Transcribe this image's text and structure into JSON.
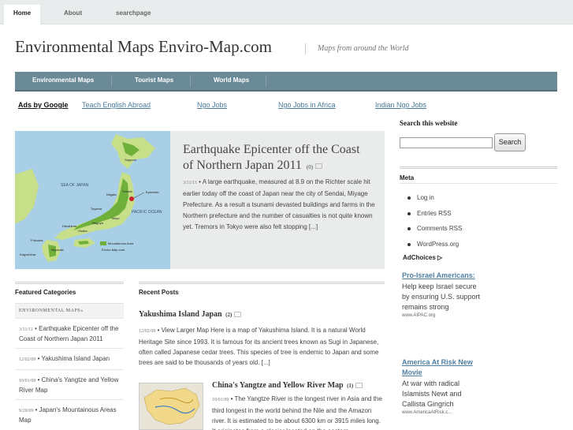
{
  "topnav": {
    "home": "Home",
    "about": "About",
    "searchpage": "searchpage"
  },
  "site": {
    "title": "Environmental Maps Enviro-Map.com",
    "tagline": "Maps from around the World"
  },
  "mainnav": {
    "items": [
      "Environmental Maps",
      "Tourist Maps",
      "World Maps"
    ]
  },
  "ads": {
    "label": "Ads by Google",
    "links": [
      "Teach English Abroad",
      "Ngo Jobs",
      "Ngo Jobs in Africa",
      "Indian Ngo Jobs"
    ]
  },
  "feature": {
    "title": "Earthquake Epicenter off the Coast of Northern Japan 2011",
    "comment_count": "(0)",
    "date": "3/11/11",
    "excerpt": " • A large earthquake, measured at 8.9 on the Richter scale hit earlier today off the coast of Japan near the city of Sendai, Miyage Prefecture. As a result a tsunami devasted buildings and farms in the Northern prefecture and the number of casualties is not quite known yet. Tremors in Tokyo were also felt stopping [...]",
    "map_labels": {
      "sea": "SEA OF JAPAN",
      "ocean": "PACIFIC OCEAN",
      "epicenter": "Epicenter",
      "legend1": "Mountainous Area",
      "legend2": "Enviro-Map.com",
      "cities": [
        "Sapporo",
        "Sendai",
        "Niigata",
        "Tokyo",
        "Nagoya",
        "Osaka",
        "Kyoto",
        "Hiroshima",
        "Fukuoka",
        "Kagoshima",
        "Shikoku",
        "Kyushu",
        "Honshu",
        "Hokkaido",
        "Toyama",
        "Kanazawa",
        "Yokohama",
        "Miyazaki"
      ]
    }
  },
  "featured": {
    "heading": "Featured Categories",
    "category": "Environmental Maps»",
    "items": [
      {
        "date": "3/11/11",
        "title": "Earthquake Epicenter off the Coast of Northern Japan 2011"
      },
      {
        "date": "12/02/09",
        "title": "Yakushima Island Japan"
      },
      {
        "date": "10/01/09",
        "title": "China's Yangtze and Yellow River Map"
      },
      {
        "date": "9/20/09",
        "title": "Japan's Mountainous Areas Map"
      }
    ]
  },
  "recent": {
    "heading": "Recent Posts",
    "post1": {
      "title": "Yakushima Island Japan",
      "count": "(2)",
      "date": "12/02/09",
      "body": " • View Larger Map Here is a map of Yakushima Island. It is a natural World Heritage Site since 1993. It is famous for its ancient trees known as Sugi in Japanese, often called Japanese cedar trees. This species of tree is endemic to Japan and some trees are said to be thousands of years old. [...]"
    },
    "post2": {
      "title": "China's Yangtze and Yellow River Map",
      "count": "(1)",
      "date": "10/01/09",
      "body": " • The Yangtze River is the longest river in Asia and the third longest in the world behind the Nile and the Amazon river. It is estimated to be about 6300 km or 3915 miles long. It originates from a glacier located on the eastern"
    }
  },
  "sidebar": {
    "search_label": "Search this website",
    "search_value": "",
    "search_button": "Search",
    "meta_heading": "Meta",
    "meta_links": [
      "Log in",
      "Entries RSS",
      "Comments RSS",
      "WordPress.org"
    ],
    "adchoices": "AdChoices",
    "ad1": {
      "title": "Pro-Israel Americans:",
      "text": "Help keep Israel secure by ensuring U.S. support remains strong",
      "url": "www.AIPAC.org"
    },
    "ad2": {
      "title": "America At Risk New Movie",
      "text": "At war with radical Islamists Newt and Callista Gingrich",
      "url": "www.AmericaAtRisk.c..."
    }
  },
  "colors": {
    "nav": "#6b8a97",
    "link": "#4a7a9a",
    "map_sea": "#a9cfe6",
    "map_land": "#c8df8a",
    "map_mountain": "#6fb03a",
    "epicenter": "#c8202a"
  }
}
